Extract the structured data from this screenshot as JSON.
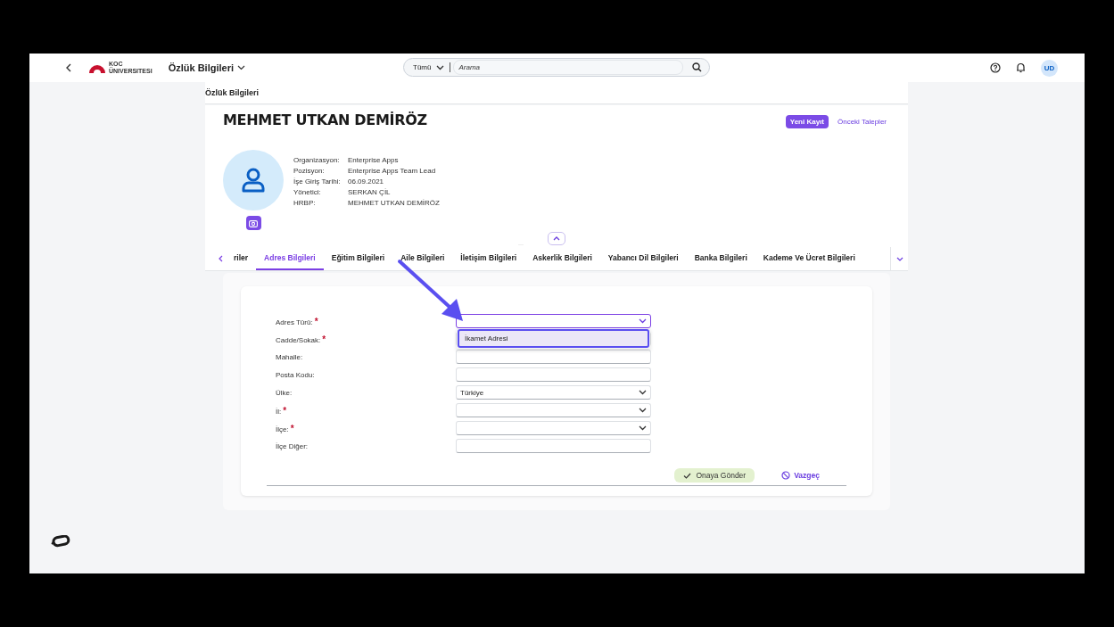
{
  "header": {
    "logo_top": "KOC",
    "logo_bottom": "ÜNIVERSITESI",
    "title": "Özlük Bilgileri"
  },
  "search": {
    "scope": "Tümü",
    "placeholder": "Arama"
  },
  "user": {
    "initials": "UD"
  },
  "page_title": "Özlük Bilgileri",
  "profile": {
    "name": "MEHMET UTKAN DEMİRÖZ",
    "actions": [
      {
        "label": "Yeni Kayıt",
        "kind": "primary"
      },
      {
        "label": "Önceki Talepler",
        "kind": "link"
      }
    ],
    "details": [
      {
        "label": "Organizasyon:",
        "value": "Enterprise Apps"
      },
      {
        "label": "Pozisyon:",
        "value": "Enterprise Apps Team Lead"
      },
      {
        "label": "İşe Giriş Tarihi:",
        "value": "06.09.2021"
      },
      {
        "label": "Yönetici:",
        "value": "SERKAN ÇİL"
      },
      {
        "label": "HRBP:",
        "value": "MEHMET UTKAN DEMİRÖZ"
      }
    ]
  },
  "tabs": [
    {
      "label": "riler",
      "selected": false
    },
    {
      "label": "Adres Bilgileri",
      "selected": true
    },
    {
      "label": "Eğitim Bilgileri",
      "selected": false
    },
    {
      "label": "Aile Bilgileri",
      "selected": false
    },
    {
      "label": "İletişim Bilgileri",
      "selected": false
    },
    {
      "label": "Askerlik Bilgileri",
      "selected": false
    },
    {
      "label": "Yabancı Dil Bilgileri",
      "selected": false
    },
    {
      "label": "Banka Bilgileri",
      "selected": false
    },
    {
      "label": "Kademe Ve Ücret Bilgileri",
      "selected": false
    }
  ],
  "form": {
    "fields": [
      {
        "label": "Adres Türü:",
        "required_mark": "*",
        "kind": "select",
        "focused": true,
        "options": [
          {
            "label": "İkamet Adresi",
            "selected": true
          }
        ]
      },
      {
        "label": "Cadde/Sokak:",
        "required_mark": "*",
        "kind": "text",
        "focused": false
      },
      {
        "label": "Mahalle:",
        "kind": "text",
        "focused": false
      },
      {
        "label": "Posta Kodu:",
        "kind": "text",
        "focused": false
      },
      {
        "label": "Ülke:",
        "kind": "select",
        "focused": false,
        "value": "Türkiye"
      },
      {
        "label": "İl:",
        "required_mark": "*",
        "kind": "select",
        "focused": false
      },
      {
        "label": "İlçe:",
        "required_mark": "*",
        "kind": "select",
        "focused": false
      },
      {
        "label": "İlçe Diğer:",
        "kind": "text",
        "focused": false
      }
    ],
    "buttons": [
      {
        "label": "Onaya Gönder",
        "kind": "submit"
      },
      {
        "label": "Vazgeç",
        "kind": "cancel"
      }
    ]
  }
}
